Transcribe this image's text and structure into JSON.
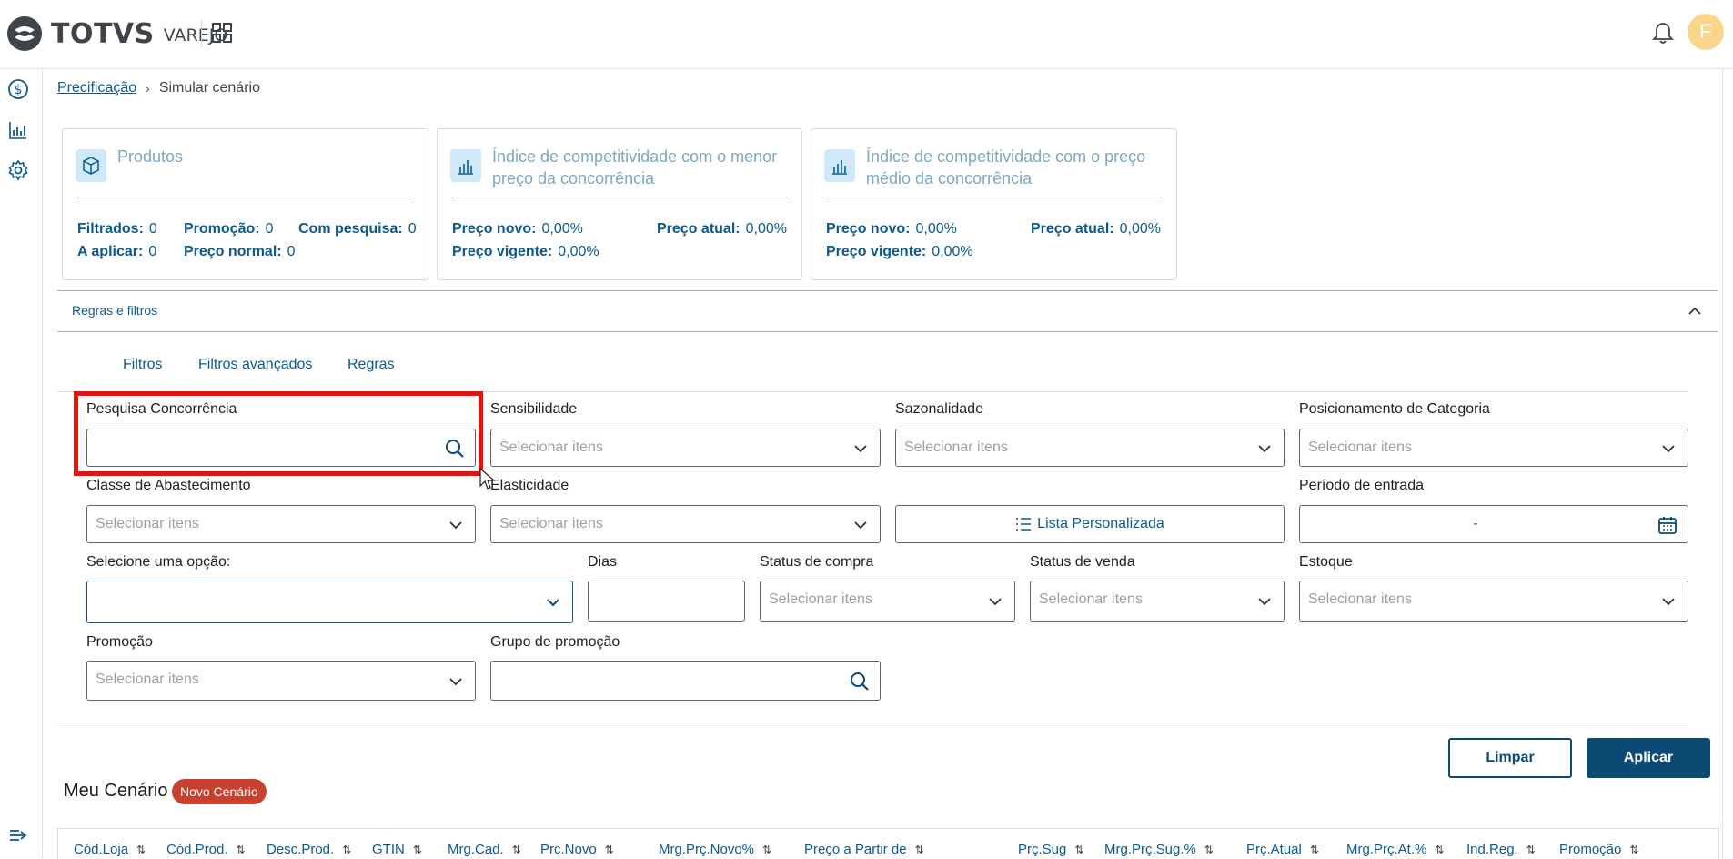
{
  "header": {
    "logo_text": "TOTVS",
    "logo_sub": "VAREJO",
    "avatar_initial": "F"
  },
  "breadcrumb": {
    "parent": "Precificação",
    "current": "Simular cenário"
  },
  "cards": [
    {
      "title": "Produtos",
      "stats": [
        {
          "label": "Filtrados:",
          "value": "0"
        },
        {
          "label": "Promoção:",
          "value": "0"
        },
        {
          "label": "Com pesquisa:",
          "value": "0"
        },
        {
          "label": "A aplicar:",
          "value": "0"
        },
        {
          "label": "Preço normal:",
          "value": "0"
        }
      ]
    },
    {
      "title_line1": "Índice de competitividade com o menor",
      "title_line2": "preço da concorrência",
      "stats": [
        {
          "label": "Preço novo:",
          "value": "0,00%"
        },
        {
          "label": "Preço atual:",
          "value": "0,00%"
        },
        {
          "label": "Preço vigente:",
          "value": "0,00%"
        }
      ]
    },
    {
      "title_line1": "Índice de competitividade com o preço",
      "title_line2": "médio da concorrência",
      "stats": [
        {
          "label": "Preço novo:",
          "value": "0,00%"
        },
        {
          "label": "Preço atual:",
          "value": "0,00%"
        },
        {
          "label": "Preço vigente:",
          "value": "0,00%"
        }
      ]
    }
  ],
  "accordion": {
    "title": "Regras e filtros"
  },
  "tabs": [
    "Filtros",
    "Filtros avançados",
    "Regras"
  ],
  "filters": {
    "placeholder": "Selecionar itens",
    "pesquisa_concorrencia": "Pesquisa Concorrência",
    "sensibilidade": "Sensibilidade",
    "sazonalidade": "Sazonalidade",
    "posicionamento": "Posicionamento de Categoria",
    "classe_abastecimento": "Classe de Abastecimento",
    "elasticidade": "Elasticidade",
    "lista_personalizada": "Lista Personalizada",
    "periodo_entrada": "Período de entrada",
    "periodo_value": "-",
    "selecione_opcao": "Selecione uma opção:",
    "dias": "Dias",
    "status_compra": "Status de compra",
    "status_venda": "Status de venda",
    "estoque": "Estoque",
    "promocao": "Promoção",
    "grupo_promocao": "Grupo de promoção"
  },
  "actions": {
    "limpar": "Limpar",
    "aplicar": "Aplicar"
  },
  "scenario": {
    "title": "Meu Cenário",
    "badge": "Novo Cenário"
  },
  "table": {
    "columns": [
      "Cód.Loja",
      "Cód.Prod.",
      "Desc.Prod.",
      "GTIN",
      "Mrg.Cad.",
      "Prc.Novo",
      "Mrg.Prç.Novo%",
      "Preço a Partir de",
      "Prç.Sug",
      "Mrg.Prç.Sug.%",
      "Prç.Atual",
      "Mrg.Prç.At.%",
      "Ind.Reg.",
      "Promoção"
    ]
  },
  "colors": {
    "primary": "#0c4a73",
    "link": "#0c5a8c",
    "badge": "#c8402f",
    "highlight": "#e8110c"
  }
}
